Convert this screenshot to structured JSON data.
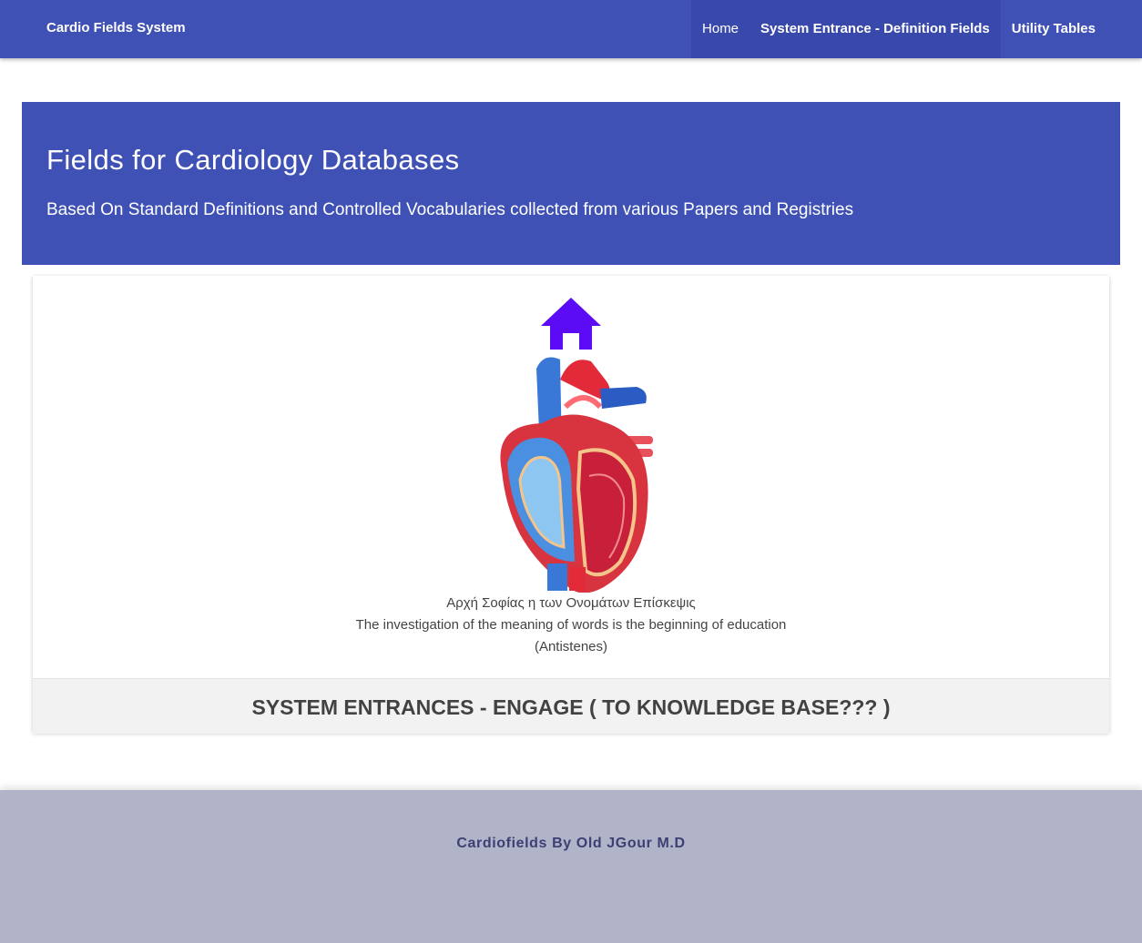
{
  "navbar": {
    "brand": "Cardio Fields System",
    "links": [
      {
        "label": "Home"
      },
      {
        "label": "System Entrance - Definition Fields"
      },
      {
        "label": "Utility Tables"
      }
    ]
  },
  "jumbotron": {
    "title": "Fields for Cardiology Databases",
    "subtitle": "Based On Standard Definitions and Controlled Vocabularies collected from various Papers and Registries"
  },
  "card": {
    "icons": [
      "home-icon",
      "heart-anatomy-image"
    ],
    "quote_greek": "Αρχή Σοφίας η των Ονομάτων Επίσκεψις",
    "quote_english": "The investigation of the meaning of words is the beginning of education",
    "quote_author": "(Antistenes)",
    "action_label": "SYSTEM ENTRANCES - ENGAGE ( TO KNOWLEDGE BASE??? )"
  },
  "footer": {
    "text": "Cardiofields By Old JGour M.D"
  },
  "colors": {
    "primary": "#3f51b5",
    "primary_dark": "#3949ab",
    "home_icon": "#5b0cf5",
    "footer_bg": "#b1b4c9"
  }
}
